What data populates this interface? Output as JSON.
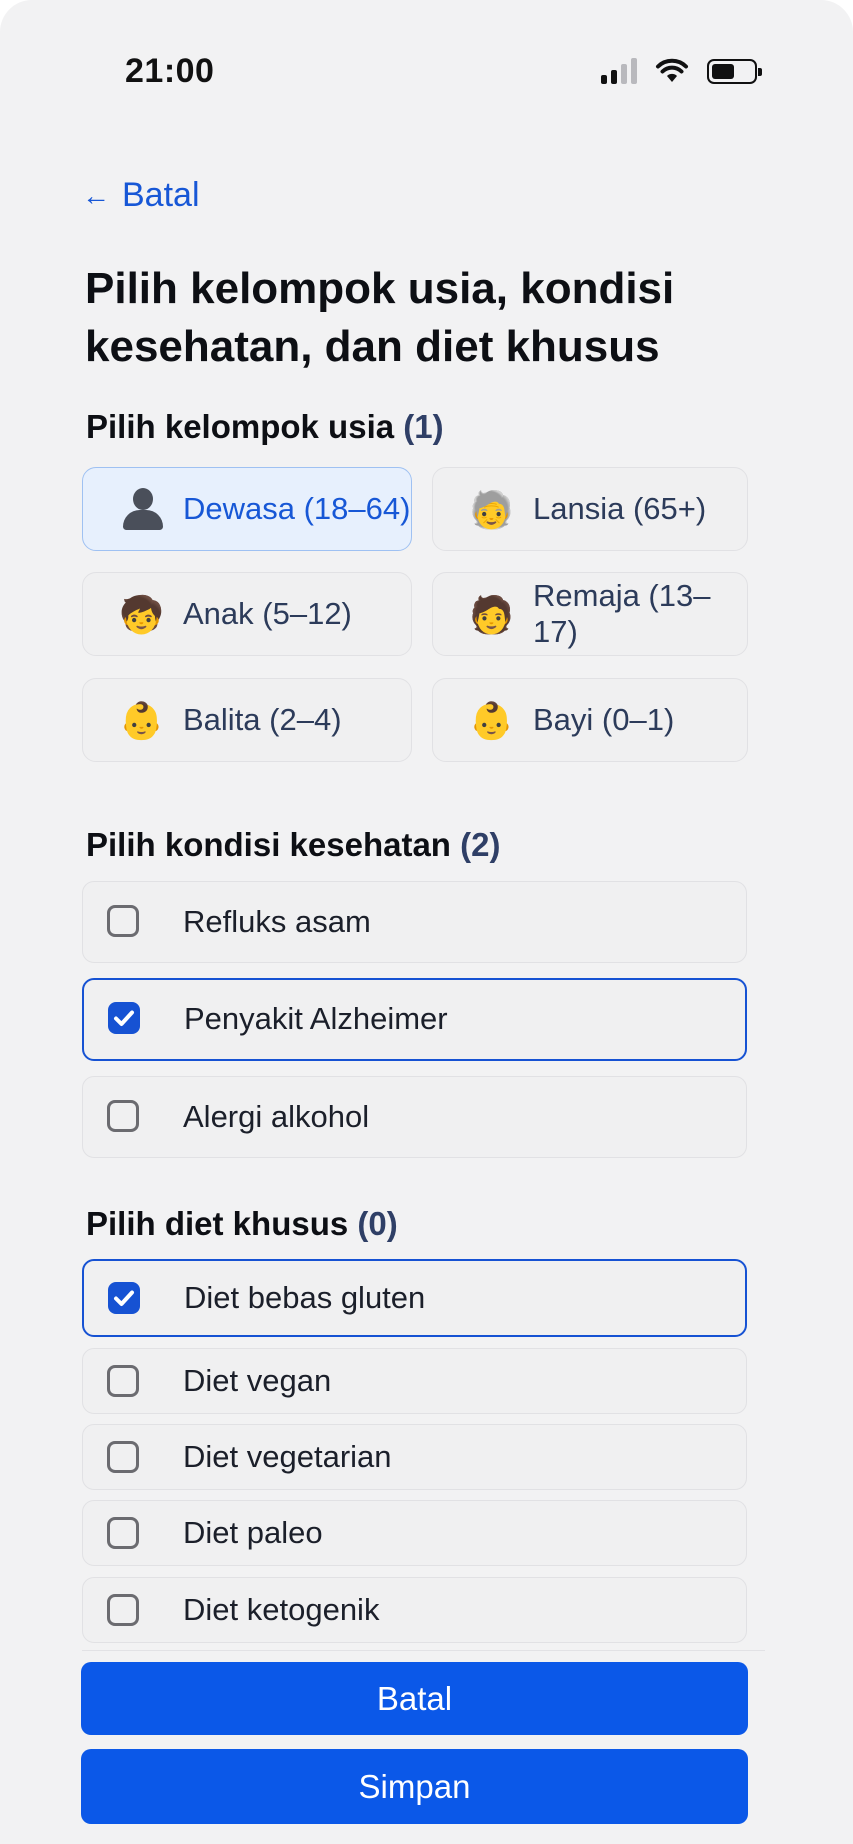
{
  "status_bar": {
    "time": "21:00",
    "battery_level": 0.55
  },
  "header": {
    "back_label": "Batal",
    "title": "Pilih kelompok usia, kondisi kesehatan, dan diet khusus"
  },
  "age_section": {
    "title": "Pilih kelompok usia",
    "count": "(1)",
    "options": [
      {
        "label": "Dewasa (18–64)",
        "icon": "person-silhouette-icon",
        "selected": true
      },
      {
        "label": "Lansia (65+)",
        "icon": "older-person-emoji",
        "emoji": "🧓",
        "selected": false
      },
      {
        "label": "Anak (5–12)",
        "icon": "child-emoji",
        "emoji": "🧒",
        "selected": false
      },
      {
        "label": "Remaja (13–17)",
        "icon": "teen-emoji",
        "emoji": "🧑",
        "selected": false
      },
      {
        "label": "Balita (2–4)",
        "icon": "toddler-emoji",
        "emoji": "👶",
        "selected": false
      },
      {
        "label": "Bayi (0–1)",
        "icon": "baby-emoji",
        "emoji": "👶",
        "selected": false
      }
    ]
  },
  "health_section": {
    "title": "Pilih kondisi kesehatan",
    "count": "(2)",
    "options": [
      {
        "label": "Refluks asam",
        "checked": false
      },
      {
        "label": "Penyakit Alzheimer",
        "checked": true
      },
      {
        "label": "Alergi alkohol",
        "checked": false
      }
    ]
  },
  "diet_section": {
    "title": "Pilih diet khusus",
    "count": "(0)",
    "options": [
      {
        "label": "Diet bebas gluten",
        "checked": true
      },
      {
        "label": "Diet vegan",
        "checked": false
      },
      {
        "label": "Diet vegetarian",
        "checked": false
      },
      {
        "label": "Diet paleo",
        "checked": false
      },
      {
        "label": "Diet ketogenik",
        "checked": false
      }
    ]
  },
  "footer": {
    "cancel_label": "Batal",
    "save_label": "Simpan"
  },
  "colors": {
    "accent": "#0b58e8",
    "background": "#f2f2f3",
    "selected_chip": "#e7f0fd"
  }
}
